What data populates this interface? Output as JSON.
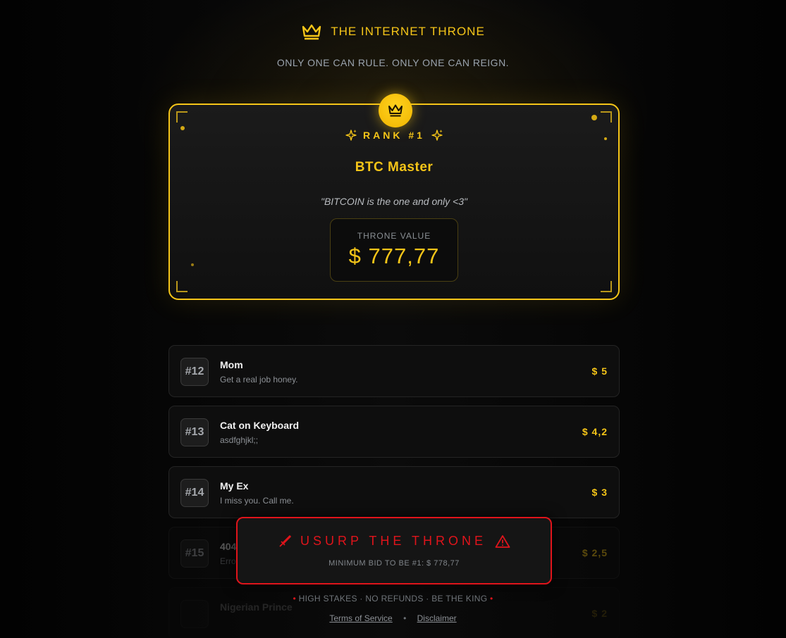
{
  "header": {
    "title": "THE INTERNET THRONE",
    "tagline": "ONLY ONE CAN RULE. ONLY ONE CAN REIGN."
  },
  "throne": {
    "rank": "RANK #1",
    "name": "BTC Master",
    "quote": "\"BITCOIN is the one and only <3\"",
    "value_label": "THRONE VALUE",
    "value": "$ 777,77"
  },
  "entries": [
    {
      "rank": "#12",
      "name": "Mom",
      "message": "Get a real job honey.",
      "amount": "$ 5"
    },
    {
      "rank": "#13",
      "name": "Cat on Keyboard",
      "message": "asdfghjkl;;",
      "amount": "$ 4,2"
    },
    {
      "rank": "#14",
      "name": "My Ex",
      "message": "I miss you. Call me.",
      "amount": "$ 3"
    },
    {
      "rank": "#15",
      "name": "404",
      "message": "Erro",
      "amount": "$ 2,5"
    },
    {
      "rank": "",
      "name": "Nigerian Prince",
      "message": "",
      "amount": "$ 2"
    }
  ],
  "usurp": {
    "label": "USURP THE THRONE",
    "min_bid": "MINIMUM BID TO BE #1: $ 778,77"
  },
  "footer": {
    "tagline": "HIGH STAKES · NO REFUNDS · BE THE KING",
    "terms": "Terms of Service",
    "separator": "•",
    "disclaimer": "Disclaimer"
  },
  "colors": {
    "gold": "#f5c518",
    "red": "#e0141b",
    "background": "#050505"
  }
}
